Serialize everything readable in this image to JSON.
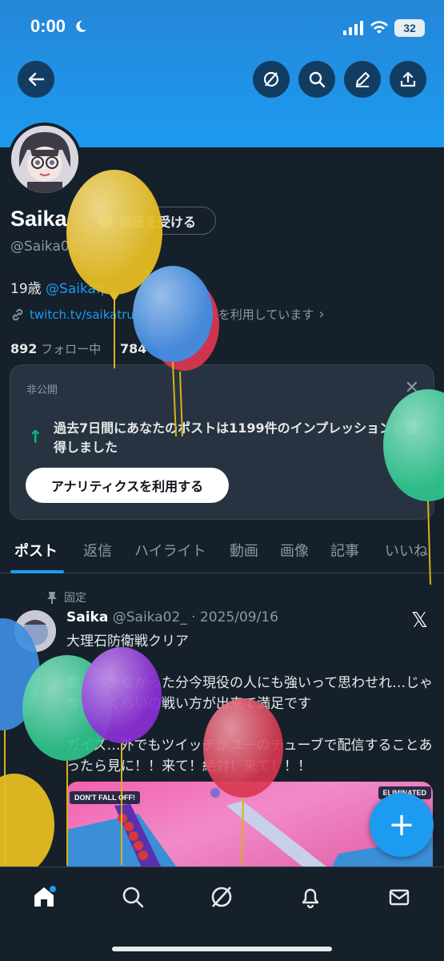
{
  "status_bar": {
    "time": "0:00",
    "battery": "32"
  },
  "header": {
    "back_icon": "arrow-left-icon",
    "buttons": [
      "grok-icon",
      "search-icon",
      "pen-icon",
      "share-icon"
    ]
  },
  "profile": {
    "name": "Saika",
    "verify_label": "認証を受ける",
    "handle": "@Saika02_",
    "bio_prefix": "19歳 ",
    "bio_mention": "@Saikafps",
    "link": "twitch.tv/saikatru",
    "joined": "23年2月からXを利用しています",
    "following_count": "892",
    "following_label": " フォロー中",
    "followers_count": "784",
    "followers_label": ""
  },
  "private_card": {
    "label": "非公開",
    "message": "過去7日間にあなたのポストは1199件のインプレッションを獲得しました",
    "button": "アナリティクスを利用する"
  },
  "tabs": [
    "ポスト",
    "返信",
    "ハイライト",
    "動画",
    "画像",
    "記事",
    "いいね"
  ],
  "active_tab": "ポスト",
  "post": {
    "pinned_label": "固定",
    "author_name": "Saika",
    "author_meta": " @Saika02_ · 2025/09/16",
    "text": "大理石防衛戦クリア\n\n開…数少なかった分今現役の人にも強いって思わせれ…じゃないかくらいの戦い方が出来て満足です\n\nガイズ…外でもツイッチかユーのチューブで配信することあったら見に！！来て！絶対！来て！！！",
    "media_tag_left": "DON'T FALL OFF!",
    "media_tag_right": "ELIMINATED"
  },
  "bottom_nav": [
    "home-icon",
    "search-icon",
    "grok-icon",
    "bell-icon",
    "mail-icon"
  ],
  "colors": {
    "accent": "#1d9bf0",
    "background": "#15202b",
    "card": "#273340"
  }
}
